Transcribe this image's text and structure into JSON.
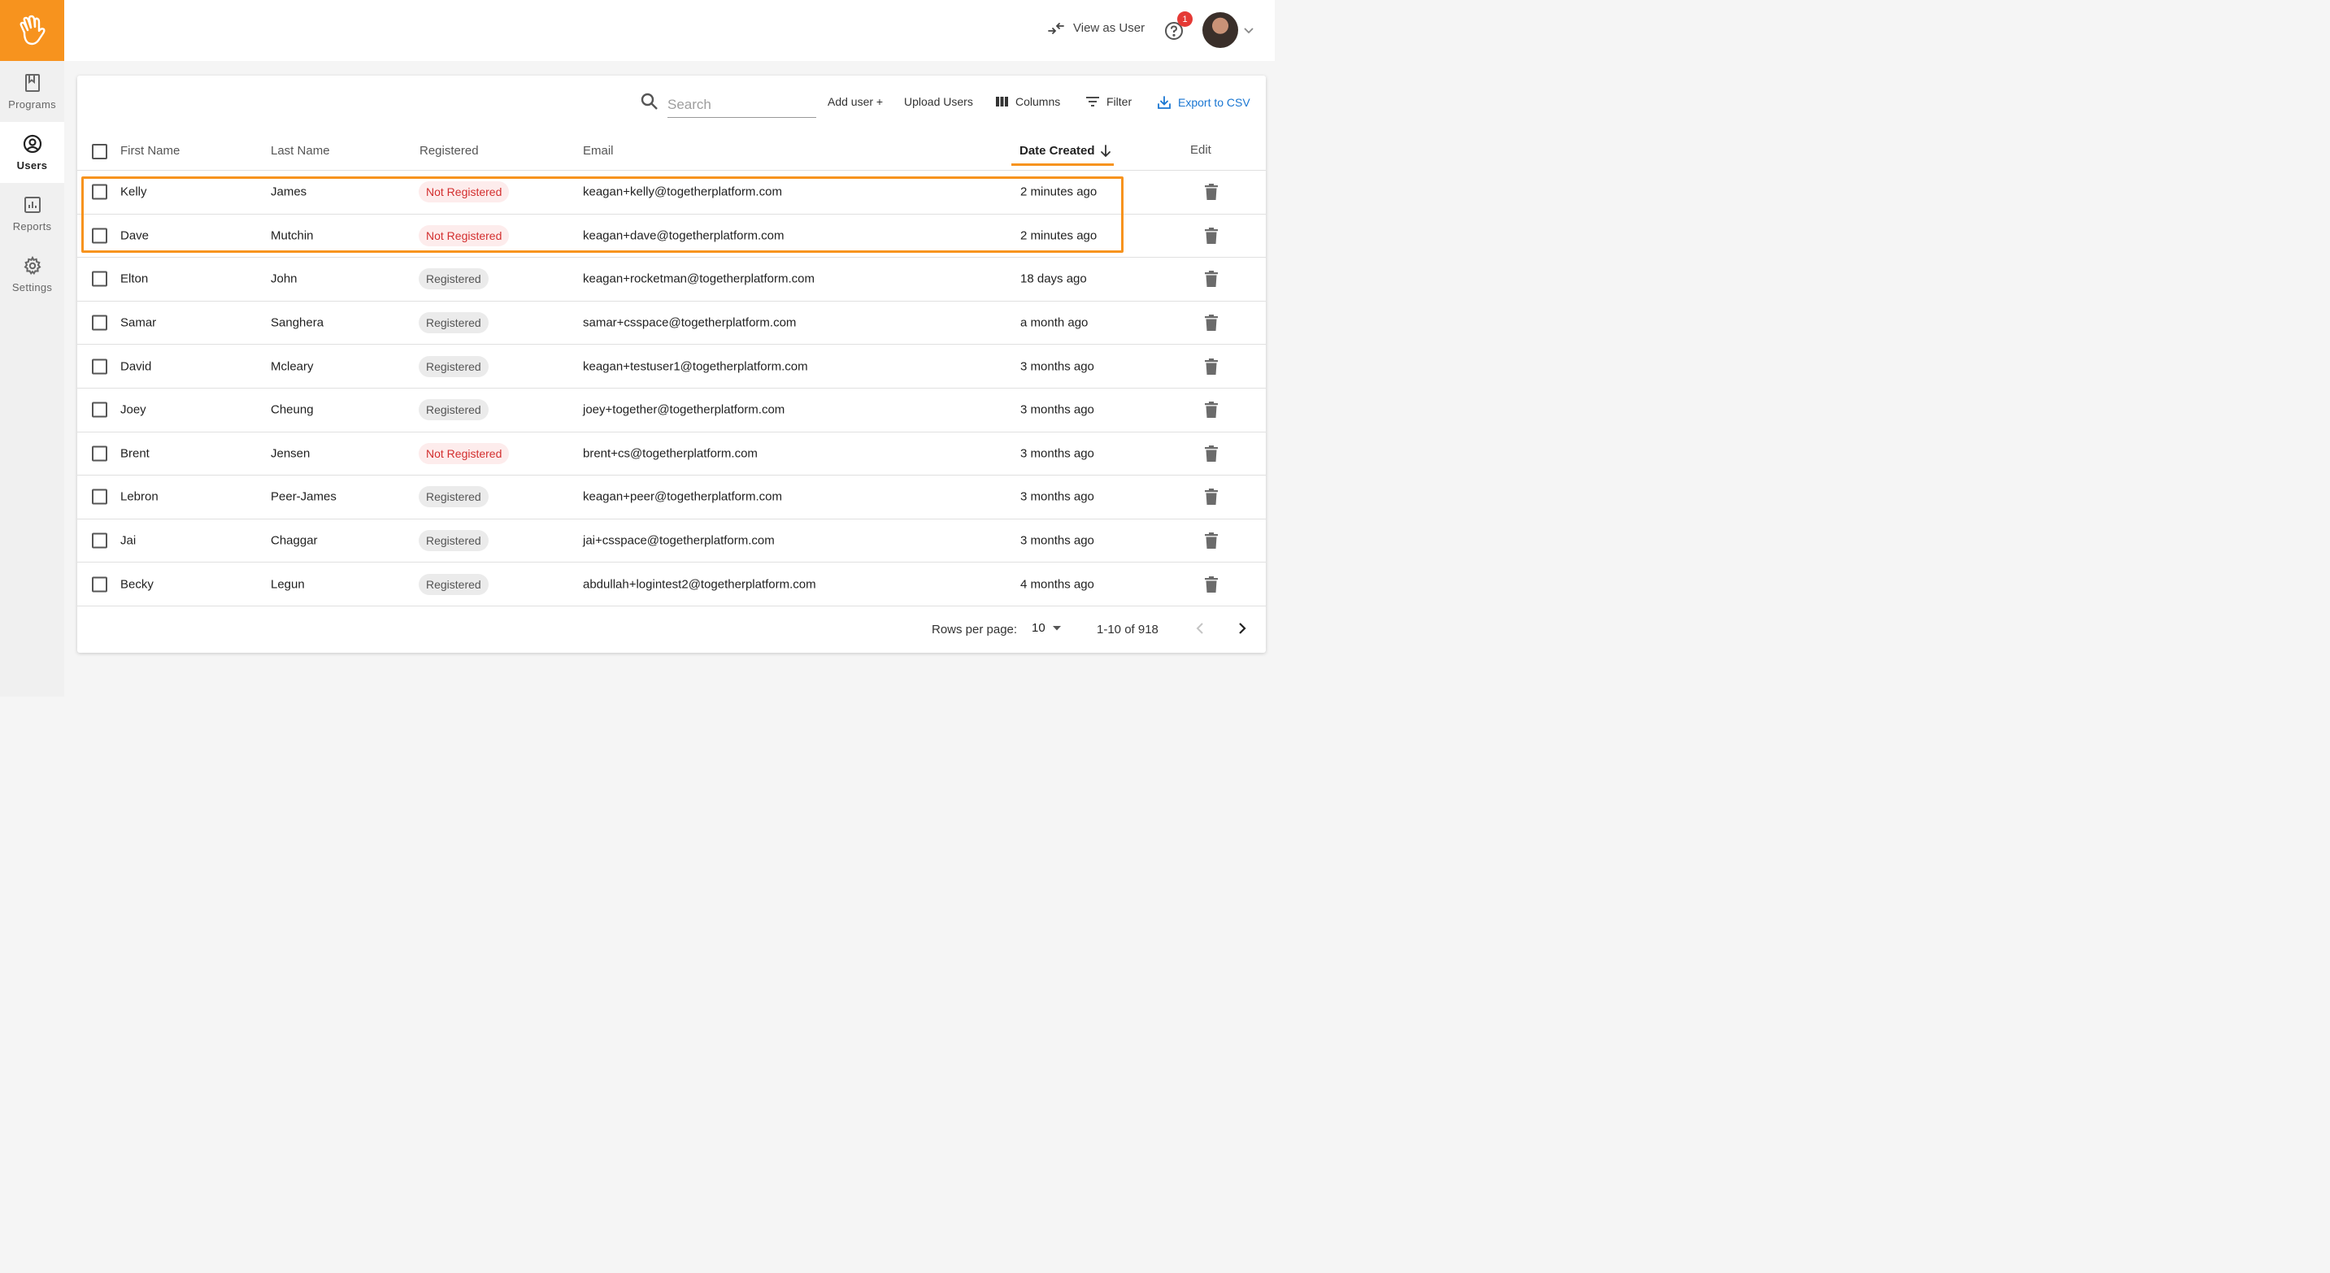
{
  "sidebar": {
    "items": [
      {
        "label": "Programs",
        "icon": "bookmark-icon"
      },
      {
        "label": "Users",
        "icon": "account-circle-icon",
        "active": true
      },
      {
        "label": "Reports",
        "icon": "bar-chart-icon"
      },
      {
        "label": "Settings",
        "icon": "gear-icon"
      }
    ]
  },
  "topbar": {
    "view_as_user": "View as User",
    "help_badge_count": "1"
  },
  "toolbar": {
    "search_placeholder": "Search",
    "add_user": "Add user +",
    "upload_users": "Upload Users",
    "columns": "Columns",
    "filter": "Filter",
    "export": "Export to CSV"
  },
  "table": {
    "headers": {
      "first_name": "First Name",
      "last_name": "Last Name",
      "registered": "Registered",
      "email": "Email",
      "date_created": "Date Created",
      "edit": "Edit"
    },
    "rows": [
      {
        "first": "Kelly",
        "last": "James",
        "status": "Not Registered",
        "registered": false,
        "email": "keagan+kelly@togetherplatform.com",
        "created": "2 minutes ago"
      },
      {
        "first": "Dave",
        "last": "Mutchin",
        "status": "Not Registered",
        "registered": false,
        "email": "keagan+dave@togetherplatform.com",
        "created": "2 minutes ago"
      },
      {
        "first": "Elton",
        "last": "John",
        "status": "Registered",
        "registered": true,
        "email": "keagan+rocketman@togetherplatform.com",
        "created": "18 days ago"
      },
      {
        "first": "Samar",
        "last": "Sanghera",
        "status": "Registered",
        "registered": true,
        "email": "samar+csspace@togetherplatform.com",
        "created": "a month ago"
      },
      {
        "first": "David",
        "last": "Mcleary",
        "status": "Registered",
        "registered": true,
        "email": "keagan+testuser1@togetherplatform.com",
        "created": "3 months ago"
      },
      {
        "first": "Joey",
        "last": "Cheung",
        "status": "Registered",
        "registered": true,
        "email": "joey+together@togetherplatform.com",
        "created": "3 months ago"
      },
      {
        "first": "Brent",
        "last": "Jensen",
        "status": "Not Registered",
        "registered": false,
        "email": "brent+cs@togetherplatform.com",
        "created": "3 months ago"
      },
      {
        "first": "Lebron",
        "last": "Peer-James",
        "status": "Registered",
        "registered": true,
        "email": "keagan+peer@togetherplatform.com",
        "created": "3 months ago"
      },
      {
        "first": "Jai",
        "last": "Chaggar",
        "status": "Registered",
        "registered": true,
        "email": "jai+csspace@togetherplatform.com",
        "created": "3 months ago"
      },
      {
        "first": "Becky",
        "last": "Legun",
        "status": "Registered",
        "registered": true,
        "email": "abdullah+logintest2@togetherplatform.com",
        "created": "4 months ago"
      }
    ]
  },
  "pagination": {
    "rows_per_page_label": "Rows per page:",
    "rows_per_page_value": "10",
    "range": "1-10 of 918"
  },
  "colors": {
    "accent": "#f7931e",
    "link": "#1976d2",
    "not_registered": "#d32f2f"
  }
}
